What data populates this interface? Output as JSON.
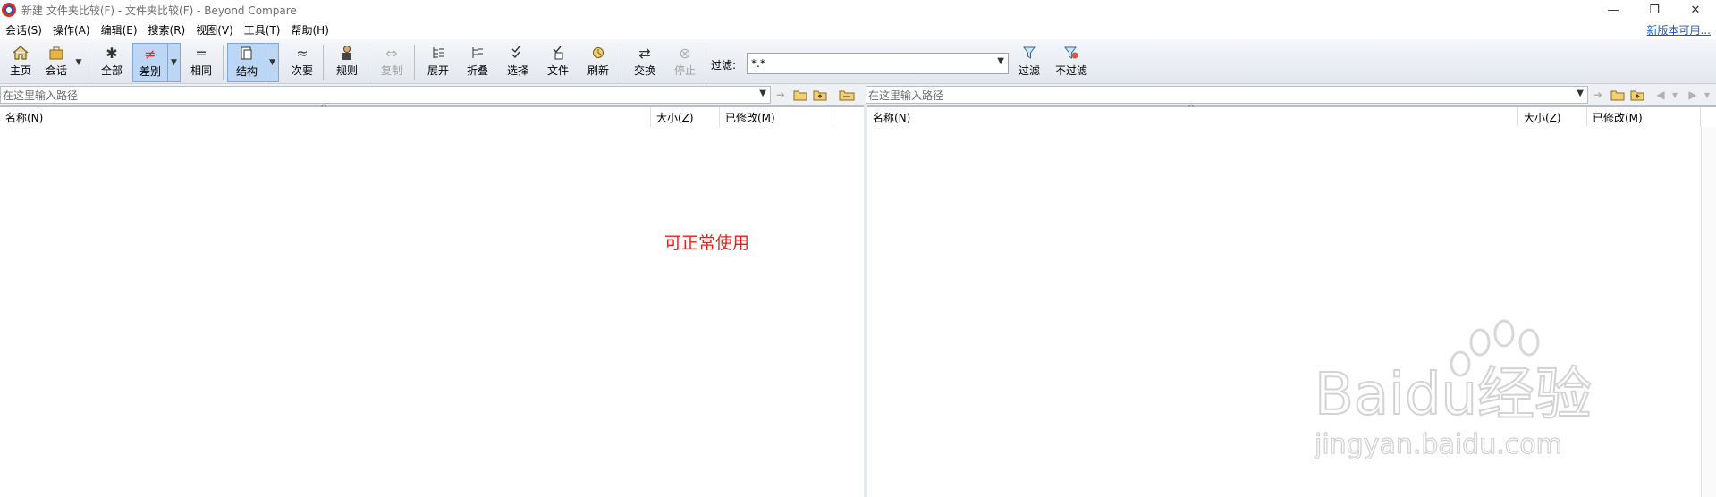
{
  "window": {
    "title": "新建 文件夹比较(F) - 文件夹比较(F) - Beyond Compare",
    "controls": {
      "minimize": "—",
      "restore": "❐",
      "close": "✕"
    }
  },
  "menu": {
    "items": [
      "会话(S)",
      "操作(A)",
      "编辑(E)",
      "搜索(R)",
      "视图(V)",
      "工具(T)",
      "帮助(H)"
    ],
    "update_link": "新版本可用..."
  },
  "toolbar": {
    "home": "主页",
    "session": "会话",
    "all": "全部",
    "diff": "差别",
    "same": "相同",
    "structure": "结构",
    "minor": "次要",
    "rules": "规则",
    "copy": "复制",
    "expand": "展开",
    "collapse": "折叠",
    "select": "选择",
    "files": "文件",
    "refresh": "刷新",
    "swap": "交换",
    "stop": "停止",
    "filter_label": "过滤:",
    "filter_value": "*.*",
    "filter": "过滤",
    "no_filter": "不过滤",
    "icons": {
      "all": "✱",
      "diff": "≠",
      "same": "=",
      "minor": "≈",
      "swap": "⇄",
      "stop": "⊗",
      "copy": "⇔"
    }
  },
  "paths": {
    "left_placeholder": "在这里输入路径",
    "right_placeholder": "在这里输入路径"
  },
  "columns": {
    "left": {
      "name": "名称(N)",
      "size": "大小(Z)",
      "modified": "已修改(M)"
    },
    "right": {
      "name": "名称(N)",
      "size": "大小(Z)",
      "modified": "已修改(M)"
    }
  },
  "annotation": "可正常使用",
  "watermark": {
    "brand": "Baidu经验",
    "url": "jingyan.baidu.com"
  },
  "colors": {
    "accent_link": "#1a56c4",
    "annotation": "#e0231c",
    "active_button": "#bcd7f5"
  }
}
